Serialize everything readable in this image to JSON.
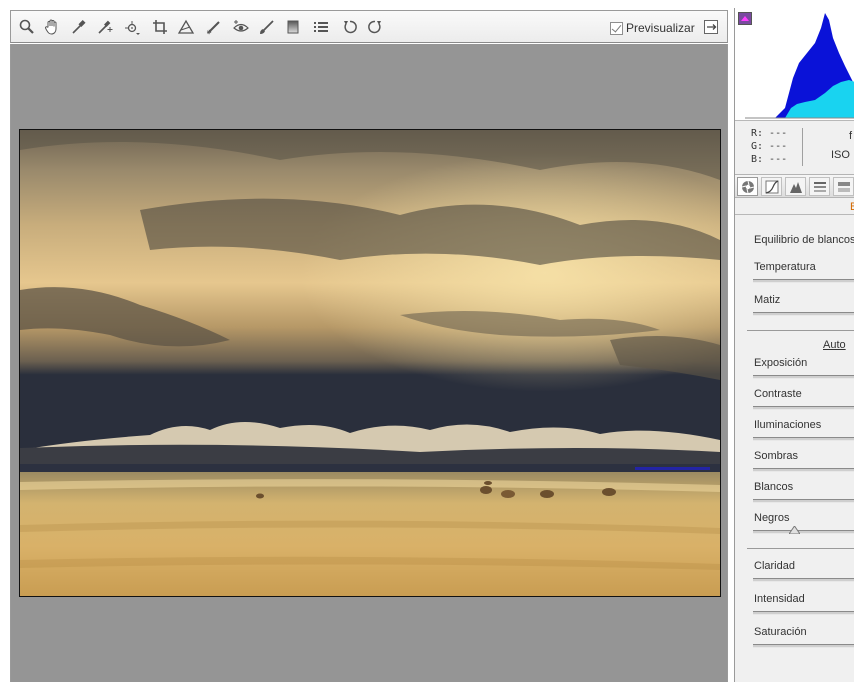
{
  "toolbar": {
    "tools": [
      {
        "icon": "zoom-icon"
      },
      {
        "icon": "hand-icon"
      },
      {
        "icon": "white-balance-eyedropper-icon"
      },
      {
        "icon": "color-sampler-icon"
      },
      {
        "icon": "targeted-adjustment-icon"
      },
      {
        "icon": "crop-icon"
      },
      {
        "icon": "straighten-icon"
      },
      {
        "icon": "spot-removal-icon"
      },
      {
        "icon": "red-eye-icon"
      },
      {
        "icon": "adjustment-brush-icon"
      },
      {
        "icon": "graduated-filter-icon"
      },
      {
        "icon": "preferences-icon"
      },
      {
        "icon": "rotate-left-icon"
      },
      {
        "icon": "rotate-right-icon"
      }
    ],
    "preview_label": "Previsualizar",
    "preview_checked": true
  },
  "readout": {
    "r": "R:  ---",
    "g": "G:  ---",
    "b": "B:  ---",
    "camera_info_1": "f",
    "camera_info_2": "ISO"
  },
  "panel": {
    "header_label": "B",
    "white_balance_label": "Equilibrio de blancos:",
    "auto_label": "Auto",
    "sliders": [
      {
        "id": "temperature",
        "label": "Temperatura"
      },
      {
        "id": "tint",
        "label": "Matiz"
      },
      {
        "id": "exposure",
        "label": "Exposición"
      },
      {
        "id": "contrast",
        "label": "Contraste"
      },
      {
        "id": "highlights",
        "label": "Iluminaciones"
      },
      {
        "id": "shadows",
        "label": "Sombras"
      },
      {
        "id": "whites",
        "label": "Blancos"
      },
      {
        "id": "blacks",
        "label": "Negros"
      },
      {
        "id": "clarity",
        "label": "Claridad"
      },
      {
        "id": "vibrance",
        "label": "Intensidad"
      },
      {
        "id": "saturation",
        "label": "Saturación"
      }
    ]
  },
  "colors": {
    "canvas_bg": "#959595",
    "panel_bg": "#f0f0f0",
    "histogram_blue": "#0a12d8",
    "histogram_cyan": "#19d3f0",
    "accent_orange": "#d46a00"
  }
}
